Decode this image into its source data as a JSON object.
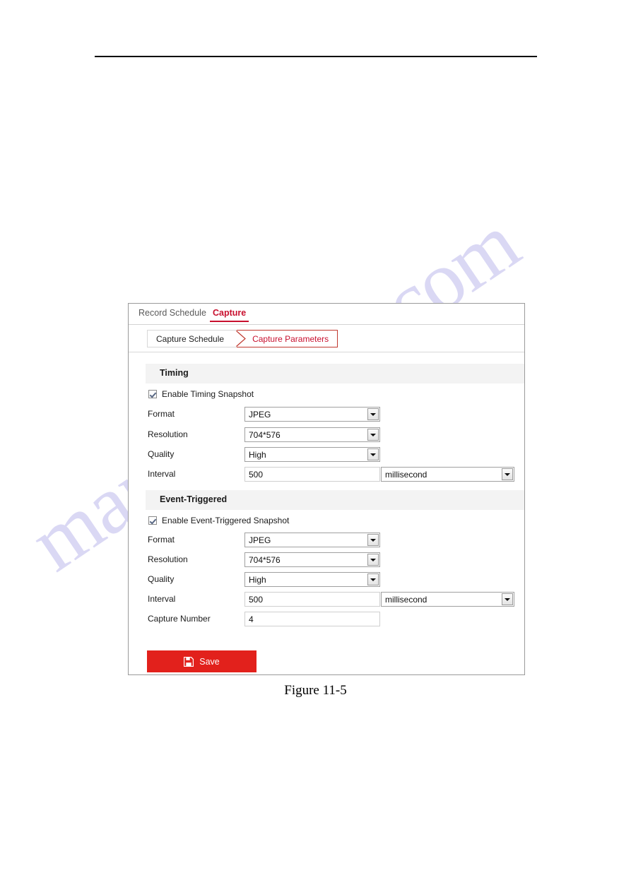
{
  "page": {
    "caption": "Figure 11-5",
    "watermark_text": "manualshive.com",
    "accent_color": "#c8102e",
    "save_color": "#e2211c"
  },
  "tabs": [
    {
      "label": "Record Schedule",
      "active": false
    },
    {
      "label": "Capture",
      "active": true
    }
  ],
  "breadcrumb": [
    {
      "label": "Capture Schedule",
      "active": false
    },
    {
      "label": "Capture Parameters",
      "active": true
    }
  ],
  "timing": {
    "band_label": "Timing",
    "enable_label": "Enable Timing Snapshot",
    "enabled": true,
    "fields": {
      "format": {
        "label": "Format",
        "value": "JPEG"
      },
      "resolution": {
        "label": "Resolution",
        "value": "704*576"
      },
      "quality": {
        "label": "Quality",
        "value": "High"
      },
      "interval": {
        "label": "Interval",
        "value": "500",
        "unit": "millisecond"
      }
    }
  },
  "event_triggered": {
    "band_label": "Event-Triggered",
    "enable_label": "Enable Event-Triggered Snapshot",
    "enabled": true,
    "fields": {
      "format": {
        "label": "Format",
        "value": "JPEG"
      },
      "resolution": {
        "label": "Resolution",
        "value": "704*576"
      },
      "quality": {
        "label": "Quality",
        "value": "High"
      },
      "interval": {
        "label": "Interval",
        "value": "500",
        "unit": "millisecond"
      },
      "capture_number": {
        "label": "Capture Number",
        "value": "4"
      }
    }
  },
  "toolbar": {
    "save_label": "Save"
  }
}
